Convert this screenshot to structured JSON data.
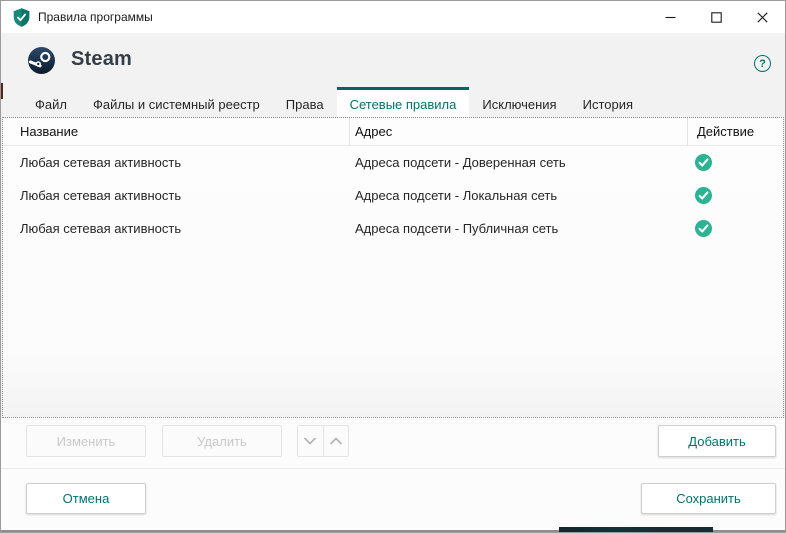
{
  "window": {
    "title": "Правила программы",
    "controls": {
      "minimize": "minimize",
      "maximize": "maximize",
      "close": "close"
    }
  },
  "header": {
    "app_name": "Steam",
    "help_glyph": "?"
  },
  "tabs": [
    {
      "label": "Файл",
      "active": false
    },
    {
      "label": "Файлы и системный реестр",
      "active": false
    },
    {
      "label": "Права",
      "active": false
    },
    {
      "label": "Сетевые правила",
      "active": true
    },
    {
      "label": "Исключения",
      "active": false
    },
    {
      "label": "История",
      "active": false
    }
  ],
  "table": {
    "columns": {
      "name": "Название",
      "address": "Адрес",
      "action": "Действие"
    },
    "rows": [
      {
        "name": "Любая сетевая активность",
        "address": "Адреса подсети - Доверенная сеть",
        "action": "allowed"
      },
      {
        "name": "Любая сетевая активность",
        "address": "Адреса подсети - Локальная сеть",
        "action": "allowed"
      },
      {
        "name": "Любая сетевая активность",
        "address": "Адреса подсети - Публичная сеть",
        "action": "allowed"
      }
    ]
  },
  "toolbar": {
    "edit_label": "Изменить",
    "delete_label": "Удалить",
    "add_label": "Добавить"
  },
  "footer": {
    "cancel_label": "Отмена",
    "save_label": "Сохранить"
  },
  "colors": {
    "accent": "#00736b",
    "tab_indicator": "#00675d",
    "check_green": "#2bb394",
    "steam_dark": "#16283b"
  }
}
